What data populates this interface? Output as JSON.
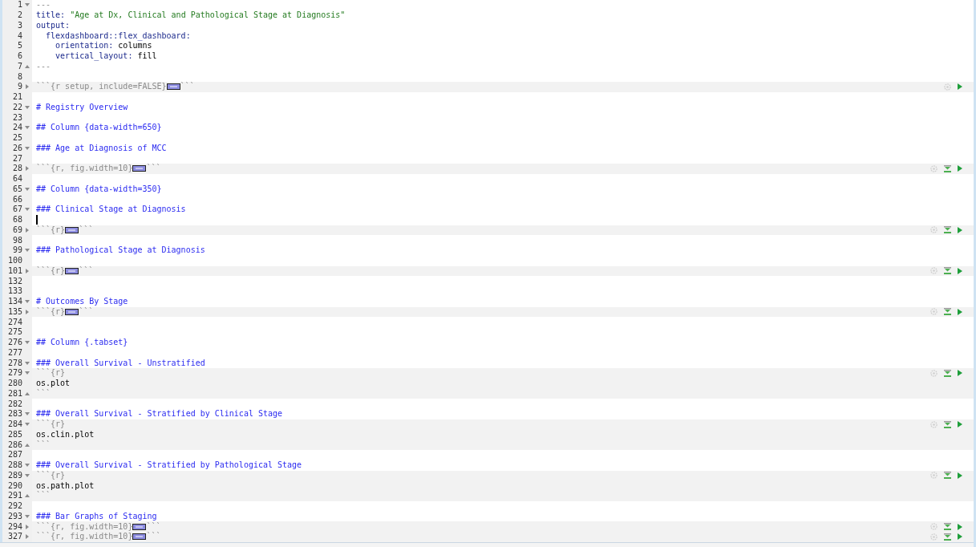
{
  "editor": {
    "lines": [
      {
        "num": "1",
        "fold": {
          "kind": "start"
        },
        "tokens": [
          {
            "kind": "meta",
            "text": "---"
          }
        ]
      },
      {
        "num": "2",
        "tokens": [
          {
            "kind": "key",
            "text": "title: "
          },
          {
            "kind": "string",
            "text": "\"Age at Dx, Clinical and Pathological Stage at Diagnosis\""
          }
        ]
      },
      {
        "num": "3",
        "tokens": [
          {
            "kind": "key",
            "text": "output:"
          }
        ]
      },
      {
        "num": "4",
        "tokens": [
          {
            "kind": "key",
            "text": "  flexdashboard::flex_dashboard:"
          }
        ]
      },
      {
        "num": "5",
        "tokens": [
          {
            "kind": "key",
            "text": "    orientation:"
          },
          {
            "kind": "plain",
            "text": " columns"
          }
        ]
      },
      {
        "num": "6",
        "tokens": [
          {
            "kind": "key",
            "text": "    vertical_layout:"
          },
          {
            "kind": "plain",
            "text": " fill"
          }
        ]
      },
      {
        "num": "7",
        "fold": {
          "kind": "end"
        },
        "tokens": [
          {
            "kind": "meta",
            "text": "---"
          }
        ]
      },
      {
        "num": "8"
      },
      {
        "num": "9",
        "fold": {
          "kind": "folded"
        },
        "chunk": true,
        "toolbar": true,
        "tokens": [
          {
            "kind": "meta",
            "text": "```{r setup, include=FALSE}"
          },
          {
            "kind": "collapsed"
          },
          {
            "kind": "meta",
            "text": "```"
          }
        ]
      },
      {
        "num": "21"
      },
      {
        "num": "22",
        "fold": {
          "kind": "start"
        },
        "tokens": [
          {
            "kind": "header",
            "text": "# Registry Overview"
          }
        ]
      },
      {
        "num": "23"
      },
      {
        "num": "24",
        "fold": {
          "kind": "start"
        },
        "tokens": [
          {
            "kind": "header",
            "text": "## Column {data-width=650}"
          }
        ]
      },
      {
        "num": "25"
      },
      {
        "num": "26",
        "fold": {
          "kind": "start"
        },
        "tokens": [
          {
            "kind": "header",
            "text": "### Age at Diagnosis of MCC"
          }
        ]
      },
      {
        "num": "27"
      },
      {
        "num": "28",
        "fold": {
          "kind": "folded"
        },
        "chunk": true,
        "toolbar": true,
        "run_above": true,
        "tokens": [
          {
            "kind": "meta",
            "text": "```{r, fig.width=10}"
          },
          {
            "kind": "collapsed"
          },
          {
            "kind": "meta",
            "text": "```"
          }
        ]
      },
      {
        "num": "64"
      },
      {
        "num": "65",
        "fold": {
          "kind": "start"
        },
        "tokens": [
          {
            "kind": "header",
            "text": "## Column {data-width=350}"
          }
        ]
      },
      {
        "num": "66"
      },
      {
        "num": "67",
        "fold": {
          "kind": "start"
        },
        "tokens": [
          {
            "kind": "header",
            "text": "### Clinical Stage at Diagnosis"
          }
        ]
      },
      {
        "num": "68",
        "cursor": true
      },
      {
        "num": "69",
        "fold": {
          "kind": "folded"
        },
        "chunk": true,
        "toolbar": true,
        "run_above": true,
        "tokens": [
          {
            "kind": "meta",
            "text": "```{r}"
          },
          {
            "kind": "collapsed"
          },
          {
            "kind": "meta",
            "text": "```"
          }
        ]
      },
      {
        "num": "98"
      },
      {
        "num": "99",
        "fold": {
          "kind": "start"
        },
        "tokens": [
          {
            "kind": "header",
            "text": "### Pathological Stage at Diagnosis"
          }
        ]
      },
      {
        "num": "100"
      },
      {
        "num": "101",
        "fold": {
          "kind": "folded"
        },
        "chunk": true,
        "toolbar": true,
        "run_above": true,
        "tokens": [
          {
            "kind": "meta",
            "text": "```{r}"
          },
          {
            "kind": "collapsed"
          },
          {
            "kind": "meta",
            "text": "```"
          }
        ]
      },
      {
        "num": "132"
      },
      {
        "num": "133"
      },
      {
        "num": "134",
        "fold": {
          "kind": "start"
        },
        "tokens": [
          {
            "kind": "header",
            "text": "# Outcomes By Stage"
          }
        ]
      },
      {
        "num": "135",
        "fold": {
          "kind": "folded"
        },
        "chunk": true,
        "toolbar": true,
        "run_above": true,
        "tokens": [
          {
            "kind": "meta",
            "text": "```{r}"
          },
          {
            "kind": "collapsed"
          },
          {
            "kind": "meta",
            "text": "```"
          }
        ]
      },
      {
        "num": "274"
      },
      {
        "num": "275"
      },
      {
        "num": "276",
        "fold": {
          "kind": "start"
        },
        "tokens": [
          {
            "kind": "header",
            "text": "## Column {.tabset}"
          }
        ]
      },
      {
        "num": "277"
      },
      {
        "num": "278",
        "fold": {
          "kind": "start"
        },
        "tokens": [
          {
            "kind": "header",
            "text": "### Overall Survival - Unstratified"
          }
        ]
      },
      {
        "num": "279",
        "fold": {
          "kind": "start"
        },
        "chunk": true,
        "toolbar": true,
        "run_above": true,
        "tokens": [
          {
            "kind": "meta",
            "text": "```{r}"
          }
        ]
      },
      {
        "num": "280",
        "chunk": true,
        "tokens": [
          {
            "kind": "plain",
            "text": "os.plot"
          }
        ]
      },
      {
        "num": "281",
        "fold": {
          "kind": "end"
        },
        "chunk": true,
        "tokens": [
          {
            "kind": "meta",
            "text": "```"
          }
        ]
      },
      {
        "num": "282"
      },
      {
        "num": "283",
        "fold": {
          "kind": "start"
        },
        "tokens": [
          {
            "kind": "header",
            "text": "### Overall Survival - Stratified by Clinical Stage"
          }
        ]
      },
      {
        "num": "284",
        "fold": {
          "kind": "start"
        },
        "chunk": true,
        "toolbar": true,
        "run_above": true,
        "tokens": [
          {
            "kind": "meta",
            "text": "```{r}"
          }
        ]
      },
      {
        "num": "285",
        "chunk": true,
        "tokens": [
          {
            "kind": "plain",
            "text": "os.clin.plot"
          }
        ]
      },
      {
        "num": "286",
        "fold": {
          "kind": "end"
        },
        "chunk": true,
        "tokens": [
          {
            "kind": "meta",
            "text": "```"
          }
        ]
      },
      {
        "num": "287"
      },
      {
        "num": "288",
        "fold": {
          "kind": "start"
        },
        "tokens": [
          {
            "kind": "header",
            "text": "### Overall Survival - Stratified by Pathological Stage"
          }
        ]
      },
      {
        "num": "289",
        "fold": {
          "kind": "start"
        },
        "chunk": true,
        "toolbar": true,
        "run_above": true,
        "tokens": [
          {
            "kind": "meta",
            "text": "```{r}"
          }
        ]
      },
      {
        "num": "290",
        "chunk": true,
        "tokens": [
          {
            "kind": "plain",
            "text": "os.path.plot"
          }
        ]
      },
      {
        "num": "291",
        "fold": {
          "kind": "end"
        },
        "chunk": true,
        "tokens": [
          {
            "kind": "meta",
            "text": "```"
          }
        ]
      },
      {
        "num": "292"
      },
      {
        "num": "293",
        "fold": {
          "kind": "start"
        },
        "tokens": [
          {
            "kind": "header",
            "text": "### Bar Graphs of Staging"
          }
        ]
      },
      {
        "num": "294",
        "fold": {
          "kind": "folded"
        },
        "chunk": true,
        "toolbar": true,
        "run_above": true,
        "tokens": [
          {
            "kind": "meta",
            "text": "```{r, fig.width=10}"
          },
          {
            "kind": "collapsed"
          },
          {
            "kind": "meta",
            "text": "```"
          }
        ]
      },
      {
        "num": "327",
        "fold": {
          "kind": "folded"
        },
        "chunk": true,
        "toolbar": true,
        "run_above": true,
        "tokens": [
          {
            "kind": "meta",
            "text": "```{r, fig.width=10}"
          },
          {
            "kind": "collapsed"
          },
          {
            "kind": "meta",
            "text": "```"
          }
        ]
      }
    ]
  }
}
